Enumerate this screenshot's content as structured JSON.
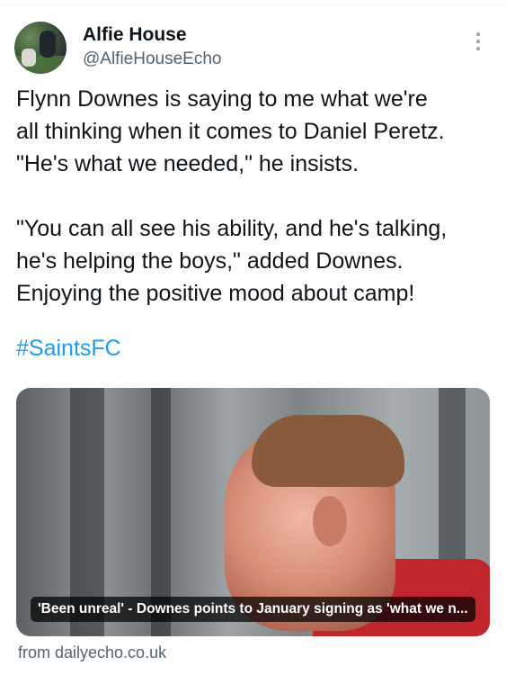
{
  "tweet": {
    "author_name": "Alfie House",
    "author_handle": "@AlfieHouseEcho",
    "paragraph1": [
      "Flynn Downes is saying to me what we're",
      "all thinking when it comes to Daniel Peretz.",
      "\"He's what we needed,\" he insists."
    ],
    "paragraph2": [
      "\"You can all see his ability, and he's talking,",
      "he's helping the boys,\" added Downes.",
      "Enjoying the positive mood about camp!"
    ],
    "hashtag": "#SaintsFC"
  },
  "link_card": {
    "caption": "'Been unreal' - Downes points to January signing as 'what we n...",
    "source": "from dailyecho.co.uk"
  },
  "colors": {
    "link": "#1d9bf0",
    "secondary_text": "#536471",
    "primary_text": "#0f1419"
  },
  "icons": {
    "more": "more-vertical-icon"
  }
}
